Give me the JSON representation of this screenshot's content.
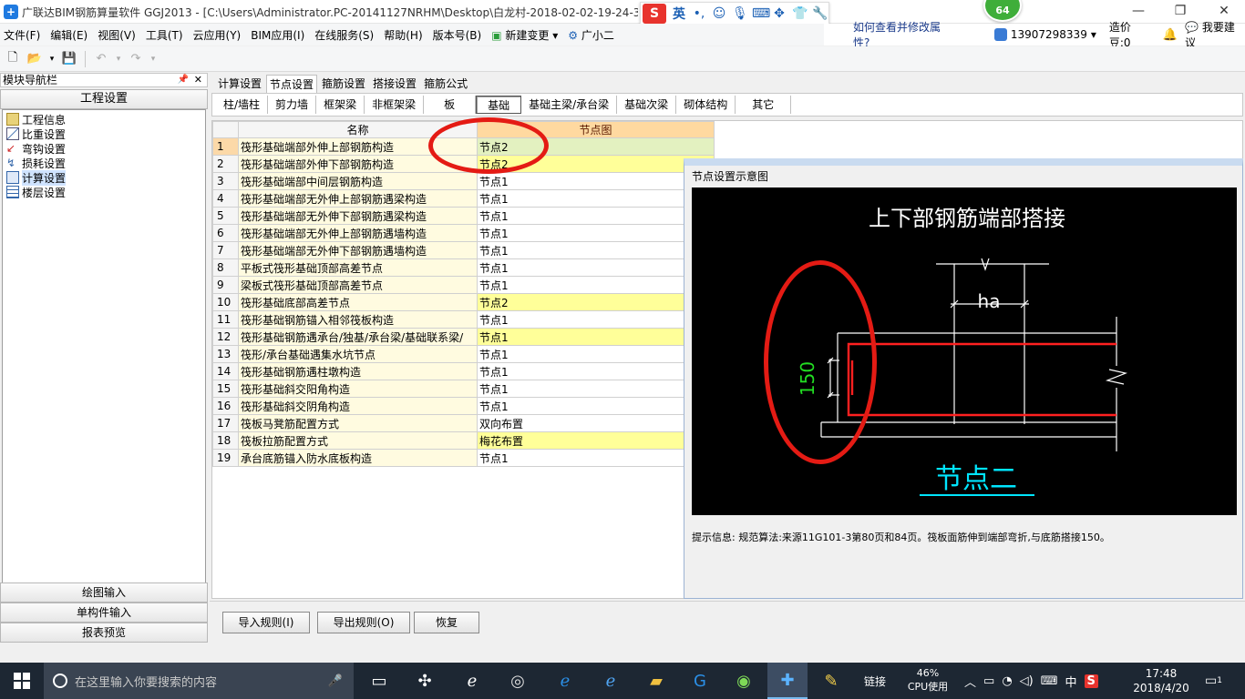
{
  "window": {
    "title": "广联达BIM钢筋算量软件 GGJ2013 - [C:\\Users\\Administrator.PC-20141127NRHM\\Desktop\\白龙村-2018-02-02-19-24-35",
    "badge": "64"
  },
  "ime": {
    "lang": "英"
  },
  "menu": {
    "items": [
      "文件(F)",
      "编辑(E)",
      "视图(V)",
      "工具(T)",
      "云应用(Y)",
      "BIM应用(I)",
      "在线服务(S)",
      "帮助(H)",
      "版本号(B)",
      "新建变更",
      "广小二"
    ],
    "help_link": "如何查看并修改属性?",
    "phone": "13907298339",
    "cost": "造价豆:0",
    "suggest": "我要建议"
  },
  "nav": {
    "title": "模块导航栏",
    "section": "工程设置",
    "items": [
      "工程信息",
      "比重设置",
      "弯钩设置",
      "损耗设置",
      "计算设置",
      "楼层设置"
    ],
    "bottom": [
      "绘图输入",
      "单构件输入",
      "报表预览"
    ]
  },
  "tabs_top": [
    "计算设置",
    "节点设置",
    "箍筋设置",
    "搭接设置",
    "箍筋公式"
  ],
  "tabs_sub": [
    "柱/墙柱",
    "剪力墙",
    "框架梁",
    "非框架梁",
    "板",
    "基础",
    "基础主梁/承台梁",
    "基础次梁",
    "砌体结构",
    "其它"
  ],
  "grid": {
    "col_name": "名称",
    "col_node": "节点图",
    "rows": [
      {
        "no": "1",
        "name": "筏形基础端部外伸上部钢筋构造",
        "value": "节点2",
        "style": "sel"
      },
      {
        "no": "2",
        "name": "筏形基础端部外伸下部钢筋构造",
        "value": "节点2",
        "style": "yel"
      },
      {
        "no": "3",
        "name": "筏形基础端部中间层钢筋构造",
        "value": "节点1",
        "style": ""
      },
      {
        "no": "4",
        "name": "筏形基础端部无外伸上部钢筋遇梁构造",
        "value": "节点1",
        "style": ""
      },
      {
        "no": "5",
        "name": "筏形基础端部无外伸下部钢筋遇梁构造",
        "value": "节点1",
        "style": ""
      },
      {
        "no": "6",
        "name": "筏形基础端部无外伸上部钢筋遇墙构造",
        "value": "节点1",
        "style": ""
      },
      {
        "no": "7",
        "name": "筏形基础端部无外伸下部钢筋遇墙构造",
        "value": "节点1",
        "style": ""
      },
      {
        "no": "8",
        "name": "平板式筏形基础顶部高差节点",
        "value": "节点1",
        "style": ""
      },
      {
        "no": "9",
        "name": "梁板式筏形基础顶部高差节点",
        "value": "节点1",
        "style": ""
      },
      {
        "no": "10",
        "name": "筏形基础底部高差节点",
        "value": "节点2",
        "style": "yel"
      },
      {
        "no": "11",
        "name": "筏形基础钢筋锚入相邻筏板构造",
        "value": "节点1",
        "style": ""
      },
      {
        "no": "12",
        "name": "筏形基础钢筋遇承台/独基/承台梁/基础联系梁/",
        "value": "节点1",
        "style": "yel"
      },
      {
        "no": "13",
        "name": "筏形/承台基础遇集水坑节点",
        "value": "节点1",
        "style": ""
      },
      {
        "no": "14",
        "name": "筏形基础钢筋遇柱墩构造",
        "value": "节点1",
        "style": ""
      },
      {
        "no": "15",
        "name": "筏形基础斜交阳角构造",
        "value": "节点1",
        "style": ""
      },
      {
        "no": "16",
        "name": "筏形基础斜交阴角构造",
        "value": "节点1",
        "style": ""
      },
      {
        "no": "17",
        "name": "筏板马凳筋配置方式",
        "value": "双向布置",
        "style": ""
      },
      {
        "no": "18",
        "name": "筏板拉筋配置方式",
        "value": "梅花布置",
        "style": "yel"
      },
      {
        "no": "19",
        "name": "承台底筋锚入防水底板构造",
        "value": "节点1",
        "style": ""
      }
    ]
  },
  "panel": {
    "title": "节点设置示意图",
    "heading": "上下部钢筋端部搭接",
    "dim_ha": "ha",
    "dim_150": "150",
    "node_label": "节点二",
    "info": "提示信息:  规范算法:来源11G101-3第80页和84页。筏板面筋伸到端部弯折,与底筋搭接150。"
  },
  "buttons": {
    "import": "导入规则(I)",
    "export": "导出规则(O)",
    "restore": "恢复"
  },
  "taskbar": {
    "search_placeholder": "在这里输入你要搜索的内容",
    "link": "链接",
    "cpu_pct": "46%",
    "cpu_label": "CPU使用",
    "lang": "中",
    "time": "17:48",
    "date": "2018/4/20",
    "notif": "1"
  },
  "colors": {
    "accent": "#1f7ae0",
    "highlight_yellow": "#ffff99",
    "mark_red": "#e41b14",
    "diagram_red": "#ff2020",
    "diagram_green": "#22dd22",
    "diagram_cyan": "#00e5ff"
  }
}
